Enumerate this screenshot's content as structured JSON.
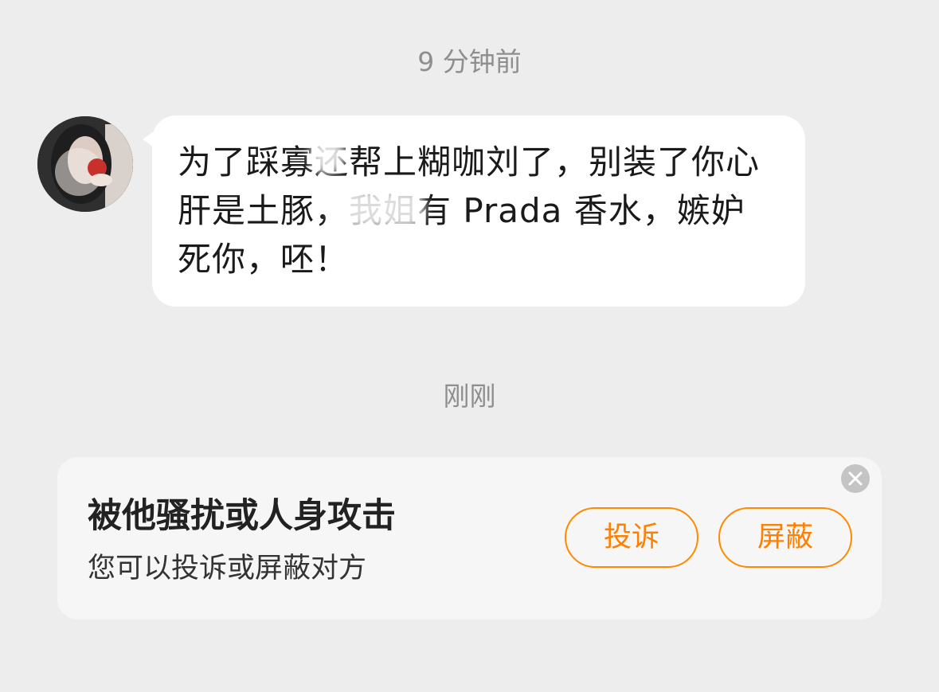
{
  "timestamps": {
    "earlier": "9 分钟前",
    "recent": "刚刚"
  },
  "message": {
    "sender_avatar": "avatar",
    "text": "为了踩寡还帮上糊咖刘了，别装了你心肝是土豚，我姐有 Prada 香水，嫉妒死你，呸！"
  },
  "report_card": {
    "title": "被他骚扰或人身攻击",
    "subtitle": "您可以投诉或屏蔽对方",
    "report_label": "投诉",
    "block_label": "屏蔽",
    "close_icon": "close-icon"
  },
  "colors": {
    "background": "#ededed",
    "accent": "#ff7f00",
    "bubble": "#ffffff",
    "card": "#f6f6f6"
  }
}
